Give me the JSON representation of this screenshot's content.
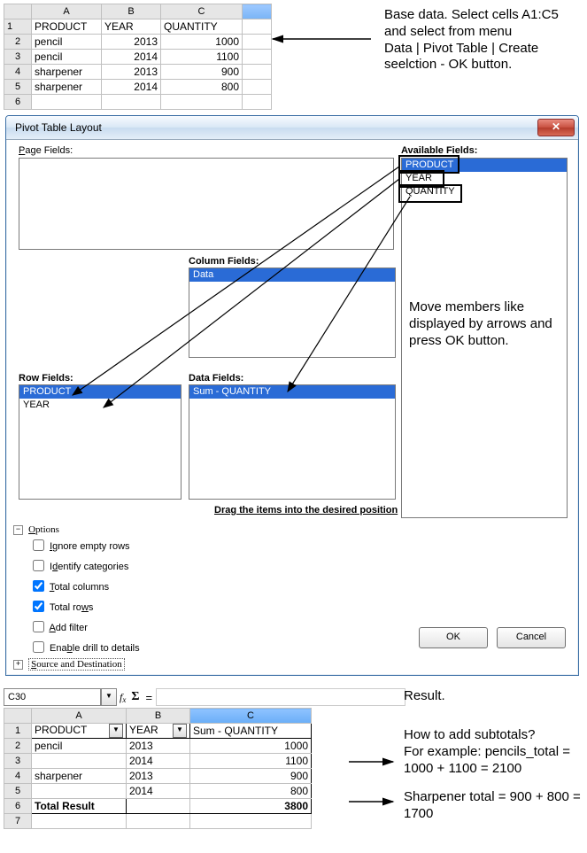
{
  "topSheet": {
    "cols": [
      "A",
      "B",
      "C"
    ],
    "headerRow": [
      "PRODUCT",
      "YEAR",
      "QUANTITY"
    ],
    "rows": [
      [
        "pencil",
        "2013",
        "1000"
      ],
      [
        "pencil",
        "2014",
        "1100"
      ],
      [
        "sharpener",
        "2013",
        "900"
      ],
      [
        "sharpener",
        "2014",
        "800"
      ]
    ]
  },
  "annot1": "Base data. Select cells A1:C5 and select from menu\nData | Pivot Table | Create seelction -  OK button.",
  "dialog": {
    "title": "Pivot Table Layout",
    "labels": {
      "page": "Page Fields:",
      "avail": "Available Fields:",
      "col": "Column Fields:",
      "row": "Row Fields:",
      "data": "Data Fields:"
    },
    "avail": [
      "PRODUCT",
      "YEAR",
      "QUANTITY"
    ],
    "columnFields": [
      "Data"
    ],
    "rowFields": [
      "PRODUCT",
      "YEAR"
    ],
    "dataFields": [
      "Sum - QUANTITY"
    ],
    "dragHint": "Drag the items into the desired position",
    "optionsLabel": "Options",
    "options": {
      "ignore": "Ignore empty rows",
      "identify": "Identify categories",
      "totalcol": "Total columns",
      "totalrow": "Total rows",
      "addfilter": "Add filter",
      "drill": "Enable drill to details"
    },
    "sourceDest": "Source and Destination",
    "ok": "OK",
    "cancel": "Cancel",
    "sideAnnot": "Move members like displayed by arrows and press OK button."
  },
  "result": {
    "cellRef": "C30",
    "equals": "=",
    "cols": [
      "A",
      "B",
      "C"
    ],
    "header": [
      "PRODUCT",
      "YEAR",
      "Sum - QUANTITY"
    ],
    "rows": [
      [
        "pencil",
        "2013",
        "1000"
      ],
      [
        "",
        "2014",
        "1100"
      ],
      [
        "sharpener",
        "2013",
        "900"
      ],
      [
        "",
        "2014",
        "800"
      ]
    ],
    "totalLabel": "Total Result",
    "totalValue": "3800",
    "annotResult": "Result.",
    "annotHow": "How to add subtotals?\nFor example: pencils_total = 1000 + 1100 = 2100",
    "annotSharp": "Sharpener total = 900 + 800 = 1700"
  }
}
